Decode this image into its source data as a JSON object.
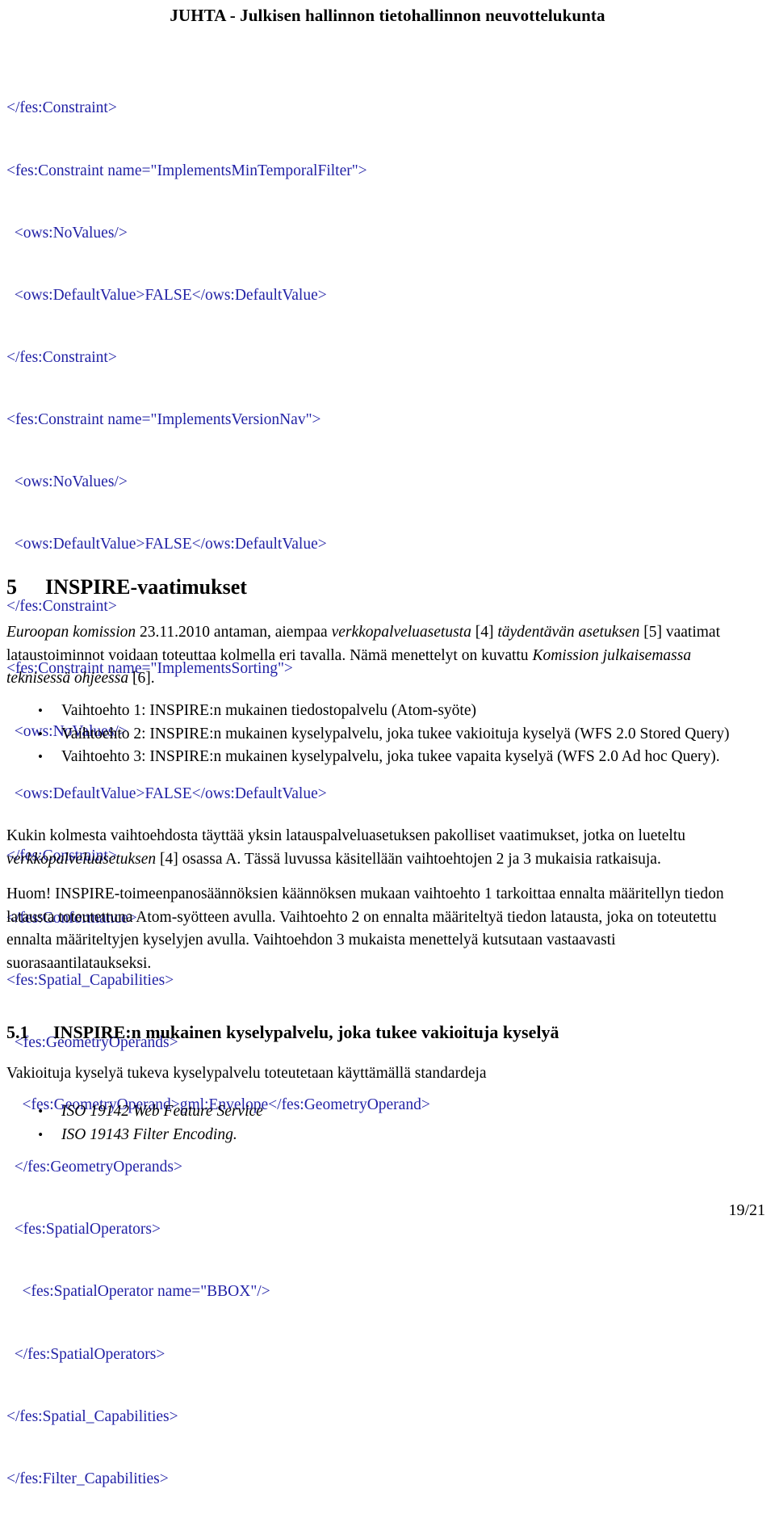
{
  "header": {
    "title": "JUHTA - Julkisen hallinnon tietohallinnon neuvottelukunta"
  },
  "code_block": {
    "language": "xml",
    "color": "#2222A6",
    "lines": [
      "</fes:Constraint>",
      "<fes:Constraint name=\"ImplementsMinTemporalFilter\">",
      "  <ows:NoValues/>",
      "  <ows:DefaultValue>FALSE</ows:DefaultValue>",
      "</fes:Constraint>",
      "<fes:Constraint name=\"ImplementsVersionNav\">",
      "  <ows:NoValues/>",
      "  <ows:DefaultValue>FALSE</ows:DefaultValue>",
      "</fes:Constraint>",
      "<fes:Constraint name=\"ImplementsSorting\">",
      "  <ows:NoValues/>",
      "  <ows:DefaultValue>FALSE</ows:DefaultValue>",
      "</fes:Constraint>",
      "</fes:Conformance>",
      "<fes:Spatial_Capabilities>",
      "  <fes:GeometryOperands>",
      "    <fes:GeometryOperand>gml:Envelope</fes:GeometryOperand>",
      "  </fes:GeometryOperands>",
      "  <fes:SpatialOperators>",
      "    <fes:SpatialOperator name=\"BBOX\"/>",
      "  </fes:SpatialOperators>",
      "</fes:Spatial_Capabilities>",
      "</fes:Filter_Capabilities>"
    ]
  },
  "section5": {
    "number": "5",
    "title": "INSPIRE-vaatimukset",
    "intro": {
      "p1_a": "Euroopan komission",
      "p1_b": " 23.11.2010 antaman, aiempaa ",
      "p1_c": "verkkopalveluasetusta",
      "p1_d": " [4] ",
      "p1_e": "täydentävän asetuksen",
      "p1_f": " [5] vaatimat lataustoiminnot voidaan toteuttaa kolmella eri tavalla. Nämä menettelyt on kuvattu ",
      "p1_g": "Komission julkaisemassa teknisessä ohjeessa",
      "p1_h": " [6]."
    },
    "options": [
      "Vaihtoehto 1: INSPIRE:n mukainen tiedostopalvelu (Atom-syöte)",
      "Vaihtoehto 2: INSPIRE:n mukainen kyselypalvelu, joka tukee vakioituja kyselyä (WFS 2.0 Stored Query)",
      "Vaihtoehto 3: INSPIRE:n mukainen kyselypalvelu, joka tukee vapaita kyselyä (WFS 2.0 Ad hoc Query)."
    ],
    "paragraph2": {
      "a": "Kukin kolmesta vaihtoehdosta täyttää yksin latauspalveluasetuksen pakolliset vaatimukset, jotka on lueteltu ",
      "b": "verkkopalveluasetuksen",
      "c": " [4] osassa A. Tässä luvussa käsitellään vaihtoehtojen 2 ja 3 mukaisia ratkaisuja."
    },
    "paragraph3": "Huom! INSPIRE-toimeenpanosäännöksien käännöksen mukaan vaihtoehto 1 tarkoittaa ennalta määritellyn tiedon latausta toteutettuna Atom-syötteen avulla. Vaihtoehto 2 on ennalta määriteltyä tiedon latausta, joka on toteutettu ennalta määriteltyjen kyselyjen avulla. Vaihtoehdon 3 mukaista menettelyä kutsutaan vastaavasti suorasaantilataukseksi."
  },
  "section51": {
    "number": "5.1",
    "title": "INSPIRE:n mukainen kyselypalvelu, joka tukee vakioituja kyselyä",
    "intro": "Vakioituja kyselyä tukeva kyselypalvelu toteutetaan käyttämällä standardeja",
    "standards": [
      "ISO 19142 Web Feature Service",
      "ISO 19143 Filter Encoding."
    ]
  },
  "footer": {
    "page_number": "19/21"
  },
  "icons": {
    "bullet": "•"
  }
}
